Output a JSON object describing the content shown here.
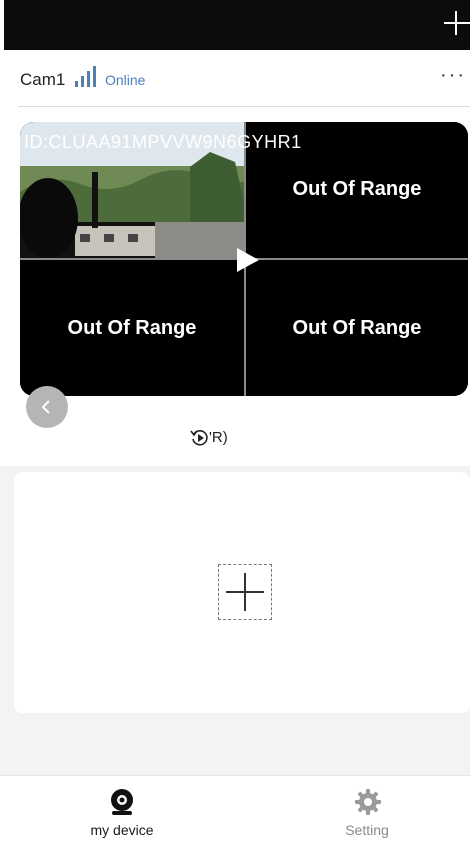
{
  "top_bar": {
    "add_icon": "plus-icon"
  },
  "device": {
    "name": "Cam1",
    "signal_icon": "signal-bars-icon",
    "status": "Online",
    "status_color": "#4b7fbf",
    "more_label": "···"
  },
  "player": {
    "device_id": "ID:CLUAA91MPVVW9N6GYHR1",
    "channels": [
      {
        "state": "live"
      },
      {
        "state": "Out Of Range"
      },
      {
        "state": "Out Of Range"
      },
      {
        "state": "Out Of Range"
      }
    ],
    "play_icon": "play-icon",
    "prev_icon": "chevron-left-icon"
  },
  "replay": {
    "icon": "replay-icon",
    "label": "'R)"
  },
  "add_device": {
    "icon": "plus-icon"
  },
  "tabs": [
    {
      "label": "my device",
      "icon": "camera-icon",
      "active": true
    },
    {
      "label": "Setting",
      "icon": "gear-icon",
      "active": false
    }
  ]
}
